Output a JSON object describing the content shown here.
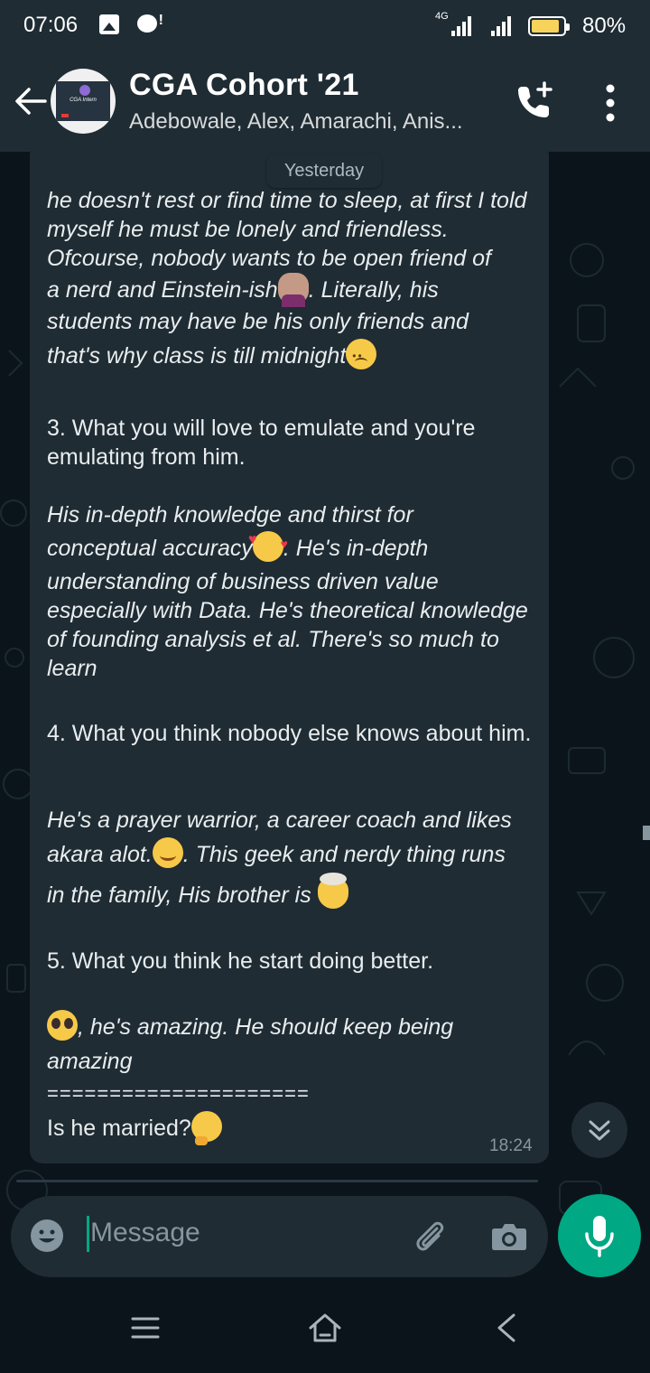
{
  "status_bar": {
    "time": "07:06",
    "network": "4G",
    "battery": "80%",
    "battery_level": 0.8
  },
  "header": {
    "title": "CGA Cohort '21",
    "subtitle": "Adebowale, Alex, Amarachi, Anis...",
    "avatar_text": "CGA Intern"
  },
  "chat": {
    "date_chip": "Yesterday",
    "time": "18:24",
    "lines": {
      "p1": "he doesn't rest or find time to sleep, at first I told myself he must be lonely and friendless. Ofcourse, nobody wants to be open friend of",
      "p1b": "a nerd and Einstein-ish",
      "p1c": ". Literally, his",
      "p1d": "students may have be his only friends and",
      "p1e": "that's why class is till midnight",
      "q3": "3. What you will love to emulate and you're emulating from him.",
      "a3a": "His in-depth knowledge and thirst for",
      "a3b": "conceptual accuracy",
      "a3c": ". He's in-depth",
      "a3d": "understanding of business driven value especially with Data. He's theoretical knowledge of founding analysis et al. There's so much to learn",
      "q4": "4. What you think nobody else knows about him.",
      "a4a": "He's a prayer warrior, a career coach and likes",
      "a4b": "akara alot.",
      "a4c": ". This geek and nerdy thing runs",
      "a4d": "in the family, His brother is ",
      "q5": "5. What you think he start doing better.",
      "a5a": ", he's amazing. He should keep being",
      "a5b": "amazing",
      "sep": "=====================",
      "last": "Is he married?"
    }
  },
  "composer": {
    "placeholder": "Message"
  },
  "icons": [
    "back-arrow-icon",
    "add-call-icon",
    "more-vert-icon",
    "emoji-icon",
    "attach-icon",
    "camera-icon",
    "mic-icon",
    "chevron-down-icon",
    "menu-icon",
    "home-icon",
    "back-nav-icon"
  ]
}
